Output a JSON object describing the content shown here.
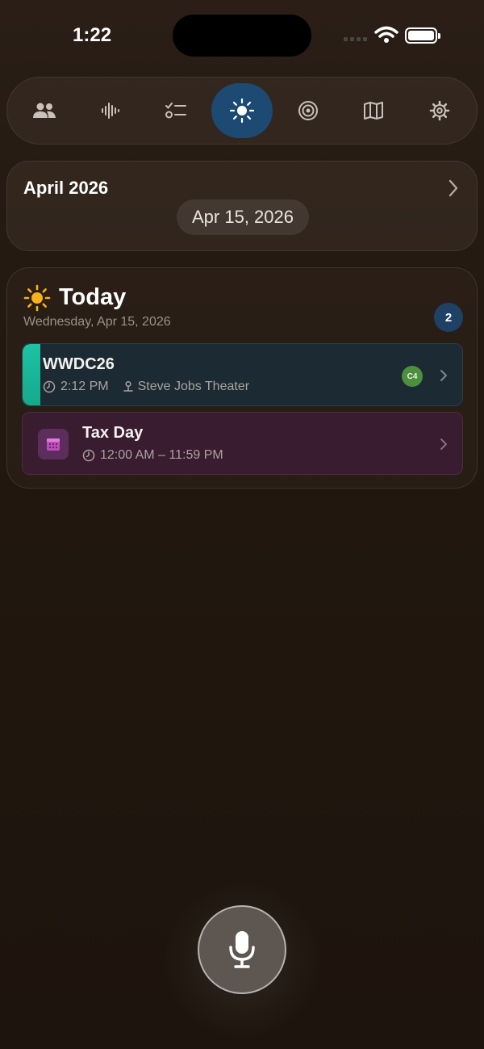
{
  "status_bar": {
    "time": "1:22"
  },
  "nav": {
    "items": [
      {
        "icon": "people-icon",
        "active": false
      },
      {
        "icon": "waveform-icon",
        "active": false
      },
      {
        "icon": "checklist-icon",
        "active": false
      },
      {
        "icon": "sun-icon",
        "active": true
      },
      {
        "icon": "target-icon",
        "active": false
      },
      {
        "icon": "map-icon",
        "active": false
      },
      {
        "icon": "gear-icon",
        "active": false
      }
    ]
  },
  "month_card": {
    "title": "April 2026",
    "selected_date": "Apr 15, 2026"
  },
  "today": {
    "title": "Today",
    "subtitle": "Wednesday, Apr 15, 2026",
    "count": "2",
    "events": [
      {
        "title": "WWDC26",
        "time": "2:12 PM",
        "location": "Steve Jobs Theater",
        "badge": "C4",
        "color": "#1ec2a4"
      },
      {
        "title": "Tax Day",
        "time": "12:00 AM – 11:59 PM",
        "color": "#c04bbd"
      }
    ]
  },
  "colors": {
    "accent": "#1c4a73",
    "badge": "#1f4166"
  }
}
